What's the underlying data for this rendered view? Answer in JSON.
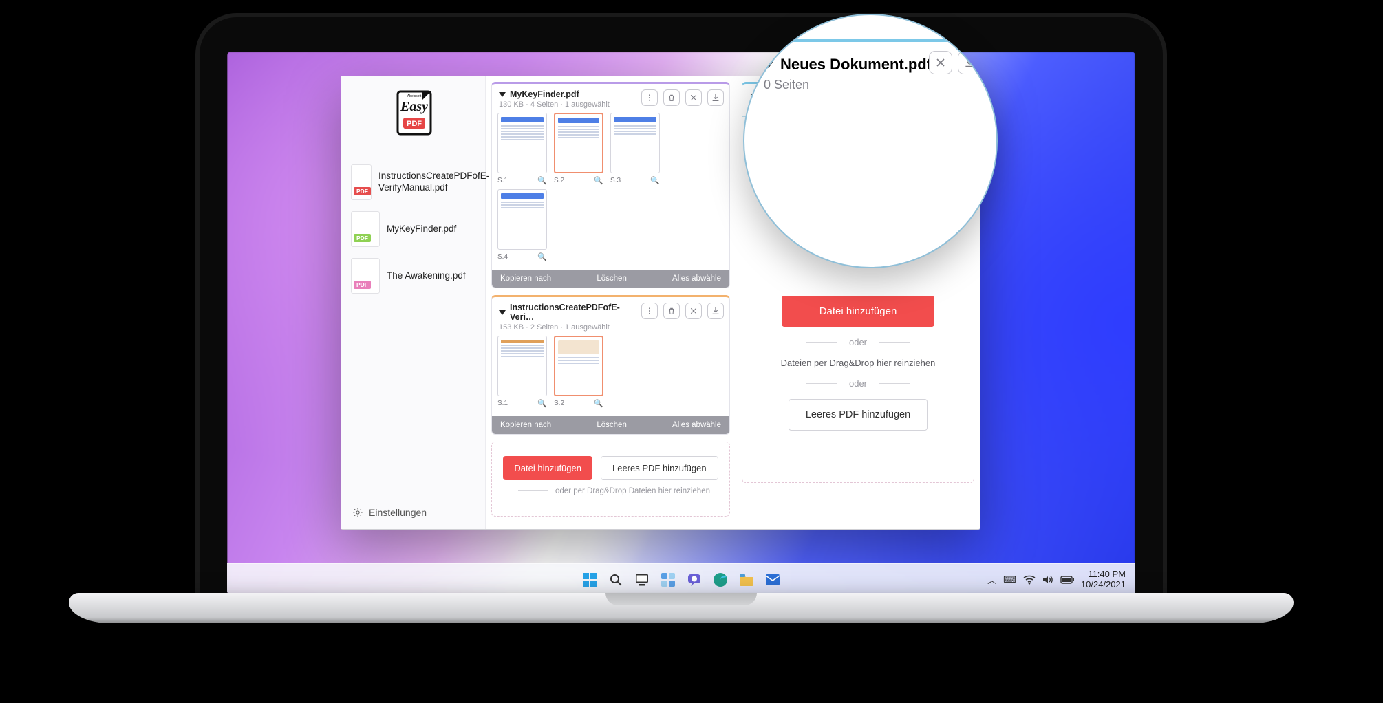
{
  "app_name": "Easy PDF",
  "window_controls": {
    "minimize": "–",
    "maximize": "□",
    "close": "✕"
  },
  "sidebar": {
    "settings_label": "Einstellungen",
    "files": [
      {
        "name": "InstructionsCreatePDFofE-VerifyManual.pdf",
        "badge": "PDF",
        "color": "c-red"
      },
      {
        "name": "MyKeyFinder.pdf",
        "badge": "PDF",
        "color": "c-green"
      },
      {
        "name": "The Awakening.pdf",
        "badge": "PDF",
        "color": "c-pink"
      }
    ]
  },
  "docs": [
    {
      "title": "MyKeyFinder.pdf",
      "meta": "130 KB  ·  4 Seiten  ·  1 ausgewählt",
      "accent": "accent-purple",
      "pages": [
        "S.1",
        "S.2",
        "S.3",
        "S.4"
      ],
      "selected_index": 1,
      "actions": {
        "copy": "Kopieren nach",
        "delete": "Löschen",
        "deselect": "Alles abwähle"
      }
    },
    {
      "title": "InstructionsCreatePDFofE-Veri…",
      "meta": "153 KB  ·  2 Seiten  ·  1 ausgewählt",
      "accent": "accent-orange",
      "pages": [
        "S.1",
        "S.2"
      ],
      "selected_index": 1,
      "actions": {
        "copy": "Kopieren nach",
        "delete": "Löschen",
        "deselect": "Alles abwähle"
      }
    }
  ],
  "mid_empty": {
    "add_file": "Datei hinzufügen",
    "add_blank": "Leeres PDF hinzufügen",
    "hint": "oder per Drag&Drop Dateien hier reinziehen"
  },
  "output": {
    "title": "Neues Dokument.pdf",
    "meta": "0 Seiten",
    "add_file": "Datei hinzufügen",
    "oder": "oder",
    "dnd": "Dateien per Drag&Drop hier reinziehen",
    "add_blank": "Leeres PDF hinzufügen"
  },
  "magnifier": {
    "title": "Neues Dokument.pdf",
    "meta": "0 Seiten"
  },
  "taskbar": {
    "time": "11:40 PM",
    "date": "10/24/2021"
  }
}
